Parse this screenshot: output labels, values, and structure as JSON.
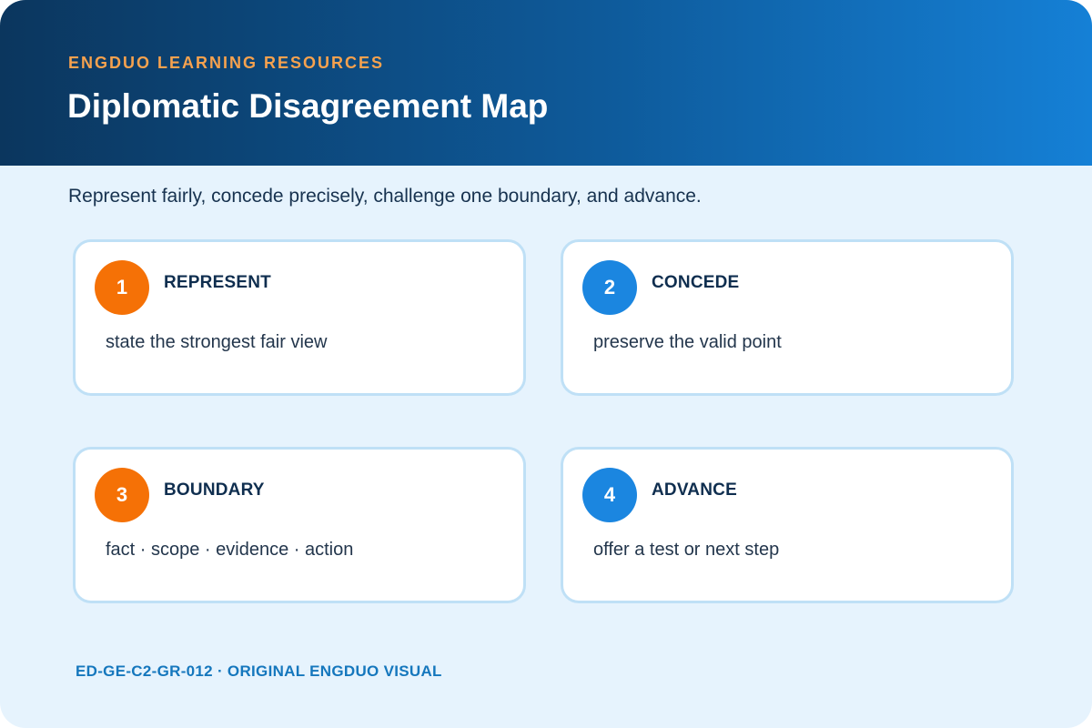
{
  "header": {
    "eyebrow": "ENGDUO LEARNING RESOURCES",
    "title": "Diplomatic Disagreement Map"
  },
  "subtitle": "Represent fairly, concede precisely, challenge one boundary, and advance.",
  "steps": [
    {
      "number": "1",
      "title": "REPRESENT",
      "description": "state the strongest fair view",
      "badge_color": "#f57106"
    },
    {
      "number": "2",
      "title": "CONCEDE",
      "description": "preserve the valid point",
      "badge_color": "#1b86e0"
    },
    {
      "number": "3",
      "title": "BOUNDARY",
      "description": "fact · scope · evidence · action",
      "badge_color": "#f57106"
    },
    {
      "number": "4",
      "title": "ADVANCE",
      "description": "offer a test or next step",
      "badge_color": "#1b86e0"
    }
  ],
  "footer": "ED-GE-C2-GR-012 · ORIGINAL ENGDUO VISUAL",
  "colors": {
    "header_gradient_start": "#0b365e",
    "header_gradient_end": "#1580d6",
    "eyebrow": "#f7a24e",
    "background": "#e6f3fd",
    "card_border": "#bfe0f6",
    "footer": "#1577bd"
  }
}
